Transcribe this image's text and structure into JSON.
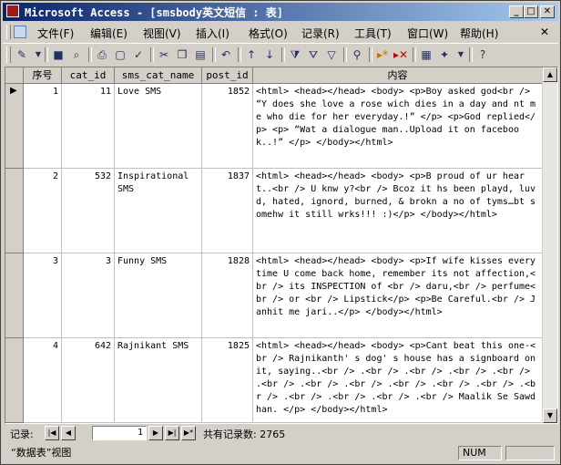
{
  "window": {
    "title": "Microsoft Access - [smsbody英文短信 : 表]",
    "minimize": "_",
    "maximize": "□",
    "close": "✕"
  },
  "menu": [
    "文件(F)",
    "编辑(E)",
    "视图(V)",
    "插入(I)",
    "格式(O)",
    "记录(R)",
    "工具(T)",
    "窗口(W)",
    "帮助(H)"
  ],
  "toolbar_icons": [
    "view-icon",
    "save-icon",
    "search-icon",
    "print-icon",
    "print-preview-icon",
    "spelling-icon",
    "cut-icon",
    "copy-icon",
    "paste-icon",
    "undo-icon",
    "sort-ascending-icon",
    "sort-descending-icon",
    "filter-by-selection-icon",
    "filter-by-form-icon",
    "apply-filter-icon",
    "find-icon",
    "new-record-icon",
    "delete-record-icon",
    "database-window-icon",
    "new-object-icon",
    "help-icon"
  ],
  "columns": [
    "序号",
    "cat_id",
    "sms_cat_name",
    "post_id",
    "内容"
  ],
  "rows": [
    {
      "seq": "1",
      "cat_id": "11",
      "cat_name": "Love SMS",
      "post_id": "1852",
      "content": "<html> <head></head> <body>  <p>Boy asked god<br /> “Y does she love a rose wich dies in a day and nt me who die for her everyday.!” </p> <p>God replied</p>  <p> “Wat a dialogue man..Upload it on facebook..!” </p> </body></html>"
    },
    {
      "seq": "2",
      "cat_id": "532",
      "cat_name": "Inspirational SMS",
      "post_id": "1837",
      "content": "<html> <head></head> <body>  <p>B proud of ur heart..<br /> U knw y?<br /> Bcoz it hs been playd, luvd, hated, ignord, burned, & brokn a no of tyms…bt somehw it still wrks!!!  :)</p> </body></html>"
    },
    {
      "seq": "3",
      "cat_id": "3",
      "cat_name": "Funny SMS",
      "post_id": "1828",
      "content": "<html> <head></head> <body>  <p>If wife kisses every time U come back home, remember its not affection,<br /> its INSPECTION of <br /> daru,<br /> perfume<br /> or <br /> Lipstick</p>   <p>Be Careful.<br /> Janhit me jari..</p> </body></html>"
    },
    {
      "seq": "4",
      "cat_id": "642",
      "cat_name": "Rajnikant SMS",
      "post_id": "1825",
      "content": "<html> <head></head> <body>  <p>Cant beat this one-<br /> Rajnikanth' s dog' s house has a signboard on it, saying..<br /> .<br /> .<br /> .<br /> .<br /> .<br /> .<br /> .<br /> .<br /> .<br /> .<br /> .<br /> .<br /> .<br /> .<br /> .<br /> Maalik Se Sawdhan.  </p>  </body></html>"
    }
  ],
  "nav": {
    "label": "记录:",
    "current": "1",
    "total_text": "共有记录数: 2765"
  },
  "status": {
    "view": "“数据表”视图",
    "num": "NUM"
  }
}
